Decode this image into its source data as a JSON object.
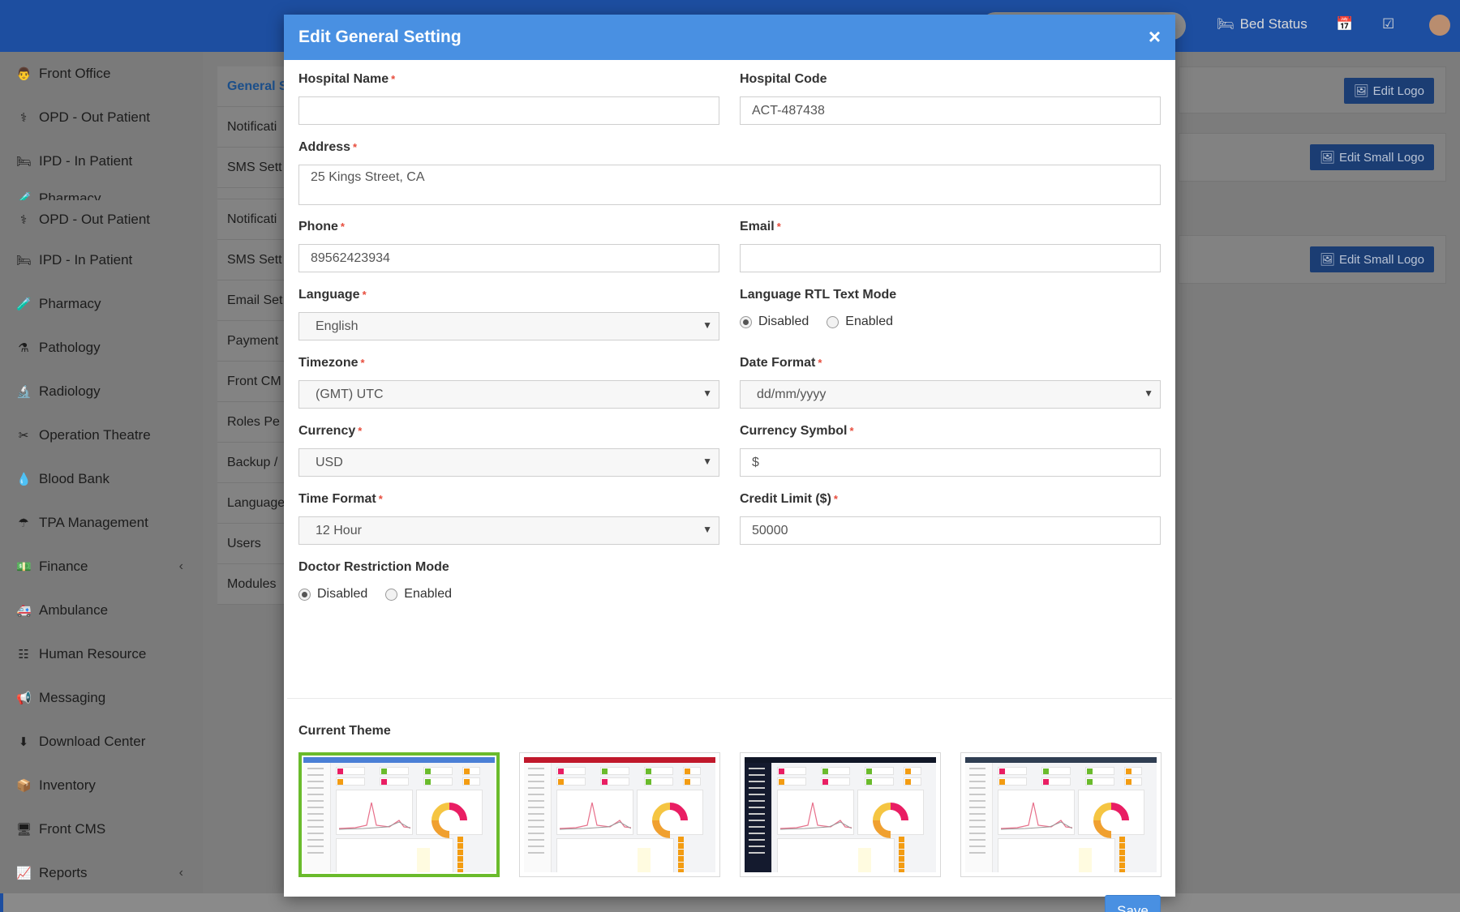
{
  "topbar": {
    "bed_status_label": "Bed Status"
  },
  "sidebar": {
    "items": [
      {
        "label": "Front Office",
        "icon": "front-office-icon"
      },
      {
        "label": "OPD - Out Patient",
        "icon": "stethoscope-icon"
      },
      {
        "label": "IPD - In Patient",
        "icon": "bed-icon"
      },
      {
        "label": "Pharmacy",
        "icon": "pharmacy-icon"
      },
      {
        "label": "OPD - Out Patient",
        "icon": "stethoscope-icon"
      },
      {
        "label": "IPD - In Patient",
        "icon": "bed-icon"
      },
      {
        "label": "Pharmacy",
        "icon": "pharmacy-icon"
      },
      {
        "label": "Pathology",
        "icon": "flask-icon"
      },
      {
        "label": "Radiology",
        "icon": "microscope-icon"
      },
      {
        "label": "Operation Theatre",
        "icon": "scissors-icon"
      },
      {
        "label": "Blood Bank",
        "icon": "blood-drop-icon"
      },
      {
        "label": "TPA Management",
        "icon": "umbrella-icon"
      },
      {
        "label": "Finance",
        "icon": "money-icon"
      },
      {
        "label": "Ambulance",
        "icon": "ambulance-icon"
      },
      {
        "label": "Human Resource",
        "icon": "sitemap-icon"
      },
      {
        "label": "Messaging",
        "icon": "bullhorn-icon"
      },
      {
        "label": "Download Center",
        "icon": "download-icon"
      },
      {
        "label": "Inventory",
        "icon": "inventory-icon"
      },
      {
        "label": "Front CMS",
        "icon": "cms-icon"
      },
      {
        "label": "Reports",
        "icon": "line-chart-icon"
      }
    ]
  },
  "settings_menu": {
    "items": [
      "General S",
      "Notificati",
      "SMS Sett",
      "Notificati",
      "SMS Sett",
      "Email Set",
      "Payment",
      "Front CM",
      "Roles Pe",
      "Backup /",
      "Language",
      "Users",
      "Modules"
    ]
  },
  "logo_panel": {
    "edit_logo": "Edit Logo",
    "edit_small_logo": "Edit Small Logo"
  },
  "modal": {
    "title": "Edit General Setting",
    "close_glyph": "×",
    "required_mark": "*",
    "hospital_name": {
      "label": "Hospital Name",
      "value": ""
    },
    "hospital_code": {
      "label": "Hospital Code",
      "value": "ACT-487438"
    },
    "address": {
      "label": "Address",
      "value": "25 Kings Street, CA"
    },
    "phone": {
      "label": "Phone",
      "value": "89562423934"
    },
    "email": {
      "label": "Email",
      "value": ""
    },
    "language": {
      "label": "Language",
      "value": "English"
    },
    "rtl_mode": {
      "label": "Language RTL Text Mode",
      "options": [
        "Disabled",
        "Enabled"
      ],
      "selected": "Disabled"
    },
    "timezone": {
      "label": "Timezone",
      "value": "(GMT) UTC"
    },
    "date_format": {
      "label": "Date Format",
      "value": "dd/mm/yyyy"
    },
    "currency": {
      "label": "Currency",
      "value": "USD"
    },
    "currency_symbol": {
      "label": "Currency Symbol",
      "value": "$"
    },
    "time_format": {
      "label": "Time Format",
      "value": "12 Hour"
    },
    "credit_limit": {
      "label": "Credit Limit ($)",
      "value": "50000"
    },
    "doctor_restriction": {
      "label": "Doctor Restriction Mode",
      "options": [
        "Disabled",
        "Enabled"
      ],
      "selected": "Disabled"
    },
    "current_theme": {
      "label": "Current Theme"
    },
    "themes": [
      {
        "name": "default",
        "header_color": "#4a7fd6",
        "sidebar_color": "#fafafa",
        "selected": true
      },
      {
        "name": "red",
        "header_color": "#c0182b",
        "sidebar_color": "#fafafa",
        "selected": false
      },
      {
        "name": "blue-dark",
        "header_color": "#101626",
        "sidebar_color": "#141a2e",
        "selected": false
      },
      {
        "name": "gray",
        "header_color": "#2f3e52",
        "sidebar_color": "#fafafa",
        "selected": false
      }
    ],
    "save_label": "Save"
  },
  "colors": {
    "primary": "#4990e2",
    "selected_theme_border": "#6abb2c",
    "required": "#e74c3c"
  }
}
